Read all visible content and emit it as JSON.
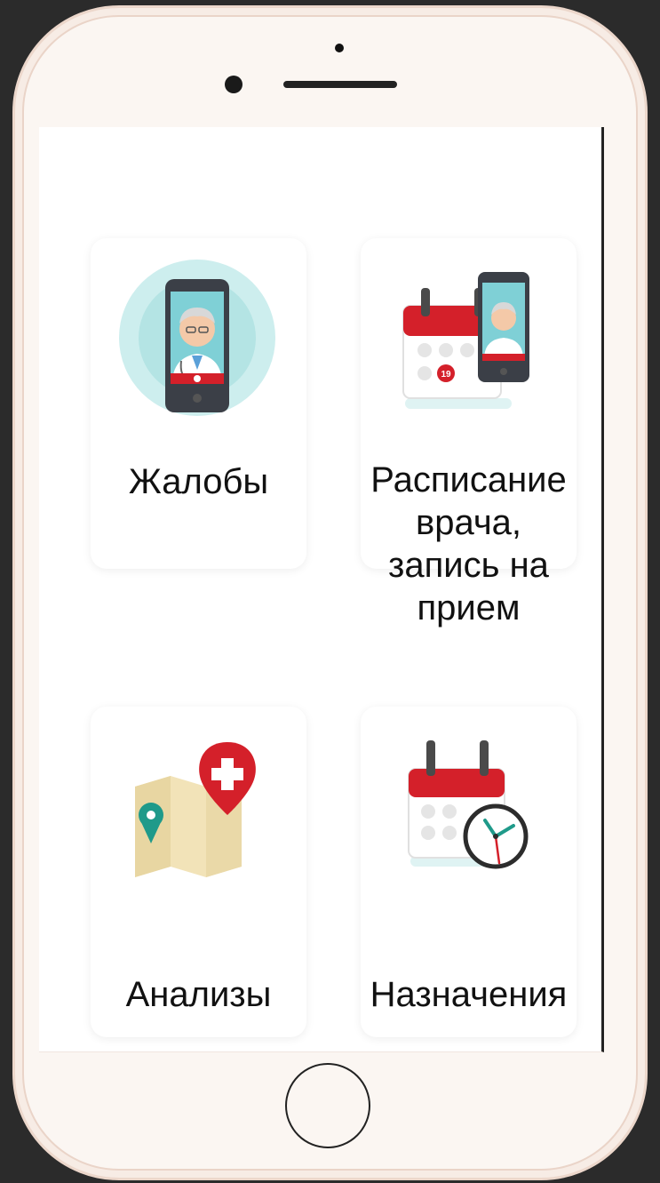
{
  "tiles": [
    {
      "label": "Жалобы",
      "icon": "doctor-phone-icon"
    },
    {
      "label": "Расписание врача, запись на прием",
      "icon": "calendar-doctor-icon",
      "calendar_date": "19"
    },
    {
      "label": "Анализы",
      "icon": "map-medical-pin-icon"
    },
    {
      "label": "Назначения",
      "icon": "calendar-clock-icon"
    }
  ],
  "colors": {
    "accent_red": "#d4202a",
    "teal": "#2a9d8f",
    "circle_bg": "#cdeeee",
    "phone_frame": "#fbf6f2"
  }
}
